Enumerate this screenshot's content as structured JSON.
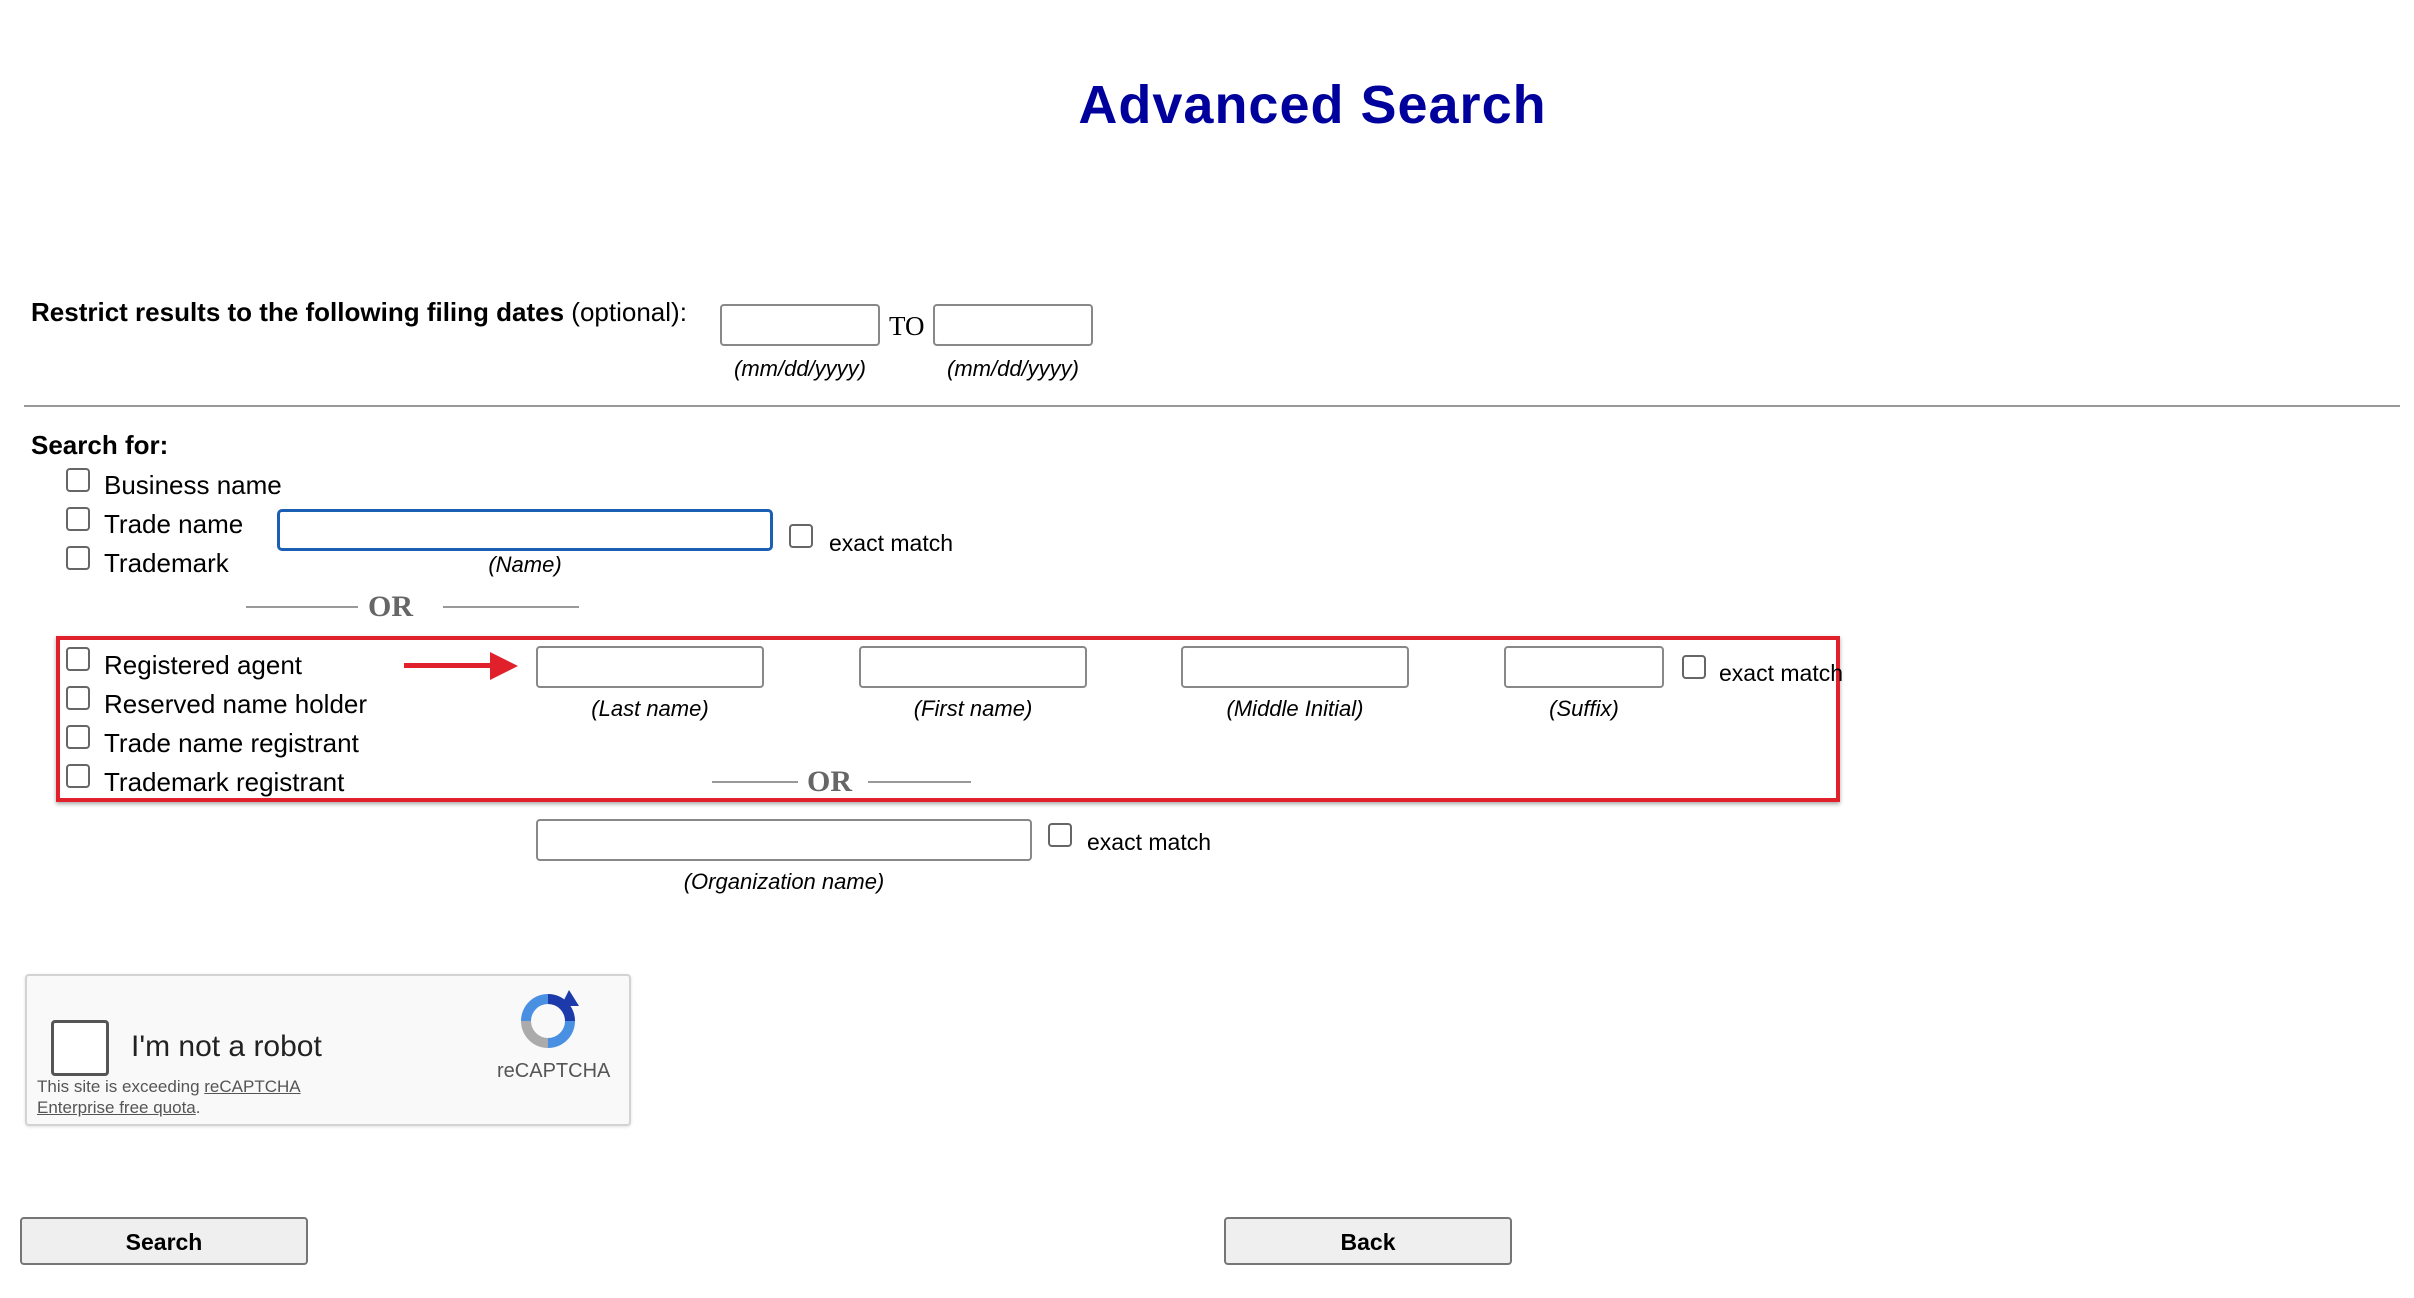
{
  "page": {
    "title": "Advanced Search"
  },
  "dates": {
    "label_bold": "Restrict results to the following filing dates",
    "label_optional": "(optional):",
    "to": "TO",
    "from_hint": "(mm/dd/yyyy)",
    "to_hint": "(mm/dd/yyyy)",
    "from_value": "",
    "to_value": ""
  },
  "search_for": {
    "heading": "Search for:",
    "business_name": "Business name",
    "trade_name": "Trade name",
    "trademark": "Trademark",
    "name_value": "",
    "name_hint": "(Name)",
    "exact_match": "exact match",
    "or": "OR"
  },
  "person": {
    "registered_agent": "Registered agent",
    "reserved_name_holder": "Reserved name holder",
    "trade_name_registrant": "Trade name registrant",
    "trademark_registrant": "Trademark registrant",
    "last_hint": "(Last name)",
    "first_hint": "(First name)",
    "middle_hint": "(Middle Initial)",
    "suffix_hint": "(Suffix)",
    "exact_match": "exact match",
    "or": "OR",
    "org_hint": "(Organization name)",
    "org_exact_match": "exact match"
  },
  "captcha": {
    "label": "I'm not a robot",
    "note_prefix": "This site is exceeding ",
    "note_link": "reCAPTCHA Enterprise free quota",
    "note_suffix": ".",
    "brand": "reCAPTCHA",
    "icon": "recaptcha-logo-icon"
  },
  "buttons": {
    "search": "Search",
    "back": "Back"
  },
  "colors": {
    "title": "#00009c",
    "highlight": "#e0202a",
    "focus": "#1a5fb4"
  }
}
